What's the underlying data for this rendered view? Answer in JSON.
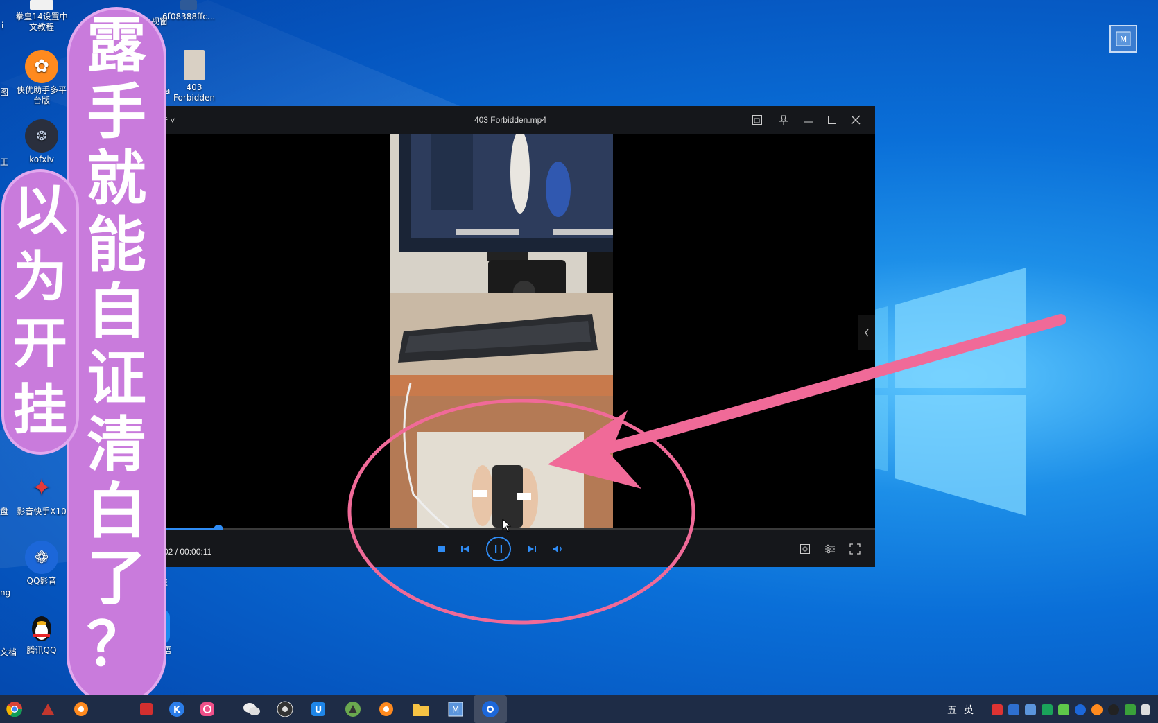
{
  "desktop": {
    "icons": [
      {
        "label": "拳皇14设置中文教程",
        "icon": "document-icon"
      },
      {
        "label": "6f08388ffc...",
        "icon": "video-file-icon"
      },
      {
        "label": "侠优助手多平台版",
        "icon": "orange-swirl-icon"
      },
      {
        "label": "403 Forbidden",
        "icon": "video-file-icon"
      },
      {
        "label": "kofxiv",
        "icon": "kof-logo-icon"
      },
      {
        "label": "影音快手X10",
        "icon": "red-flare-icon"
      },
      {
        "label": "QQ影音",
        "icon": "qqplayer-icon"
      },
      {
        "label": "腾讯QQ",
        "icon": "qq-penguin-icon"
      },
      {
        "label": "转语",
        "icon": "speech-convert-icon"
      }
    ],
    "partial_labels": [
      "i",
      "图",
      "王",
      "盘",
      "ng",
      "文档",
      "视窗",
      "eta",
      "列表"
    ]
  },
  "player": {
    "title": "403 Forbidden.mp4",
    "menu_label": "音",
    "current_time": "0:02",
    "total_time": "00:00:11",
    "time_text": "0:02 / 00:00:11",
    "progress_fraction": 0.1
  },
  "caption": {
    "column_right": [
      "露",
      "手",
      "就",
      "能",
      "自",
      "证",
      "清",
      "白",
      "了",
      "？"
    ],
    "column_left": [
      "以",
      "为",
      "开",
      "挂"
    ]
  },
  "taskbar": {
    "ime_indicator_1": "五",
    "ime_indicator_2": "英"
  },
  "colors": {
    "desktop_blue": "#0a6fd8",
    "annotation_pink": "#f06a98",
    "caption_pill": "#c97bdc",
    "player_accent": "#2f8cf5"
  }
}
